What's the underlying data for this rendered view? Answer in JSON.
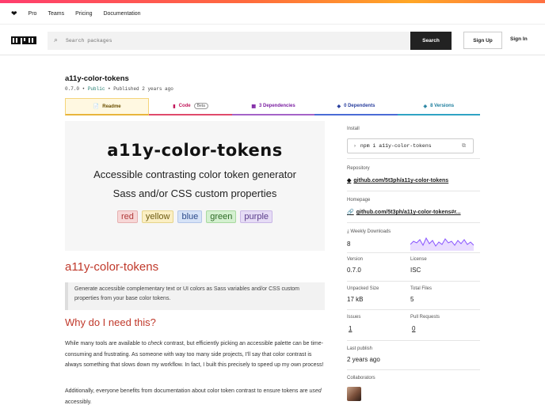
{
  "topnav": {
    "brand_icon": "heart-icon",
    "links": [
      "Pro",
      "Teams",
      "Pricing",
      "Documentation"
    ]
  },
  "header": {
    "logo_text": "npm",
    "search_placeholder": "Search packages",
    "search_button": "Search",
    "signup": "Sign Up",
    "signin": "Sign In"
  },
  "package": {
    "name": "a11y-color-tokens",
    "version": "0.7.0",
    "visibility": "Public",
    "published": "Published 2 years ago"
  },
  "tabs": {
    "readme": "Readme",
    "code": "Code",
    "code_badge": "Beta",
    "dependencies": "3 Dependencies",
    "dependents": "0 Dependents",
    "versions": "8 Versions"
  },
  "banner": {
    "title": "a11y-color-tokens",
    "subtitle1": "Accessible contrasting color token generator",
    "subtitle2": "Sass and/or CSS custom properties",
    "chips": [
      {
        "label": "red",
        "bg": "#f7d7d7",
        "fg": "#b03a3a",
        "border": "#e6b0b0"
      },
      {
        "label": "yellow",
        "bg": "#fbefc4",
        "fg": "#6b5a10",
        "border": "#e6d48a"
      },
      {
        "label": "blue",
        "bg": "#d6e3f7",
        "fg": "#2b4a8a",
        "border": "#b3c6e8"
      },
      {
        "label": "green",
        "bg": "#d4f0d0",
        "fg": "#2d6a25",
        "border": "#a8d9a0"
      },
      {
        "label": "purple",
        "bg": "#e6dcf5",
        "fg": "#5a3c8a",
        "border": "#c9b6e6"
      }
    ]
  },
  "readme": {
    "heading": "a11y-color-tokens",
    "blockquote": "Generate accessible complementary text or UI colors as Sass variables and/or CSS custom properties from your base color tokens.",
    "why_heading": "Why do I need this?",
    "para1_a": "While many tools are available to ",
    "para1_em": "check",
    "para1_b": " contrast, but efficiently picking an accessible palette can be time-consuming and frustrating. As someone with way too many side projects, I'll say that color contrast is always something that slows down my workflow. In fact, I built this precisely to speed up my own process!",
    "para2_a": "Additionally, everyone benefits from documentation about color token contrast to ensure tokens are ",
    "para2_em": "used",
    "para2_b": " accessibly."
  },
  "sidebar": {
    "install_label": "Install",
    "install_cmd": "npm i a11y-color-tokens",
    "repository_label": "Repository",
    "repository_link": "github.com/5t3ph/a11y-color-tokens",
    "homepage_label": "Homepage",
    "homepage_link": "github.com/5t3ph/a11y-color-tokens#r...",
    "weekly_label": "Weekly Downloads",
    "weekly_value": "8",
    "version_label": "Version",
    "version_value": "0.7.0",
    "license_label": "License",
    "license_value": "ISC",
    "unpacked_label": "Unpacked Size",
    "unpacked_value": "17 kB",
    "files_label": "Total Files",
    "files_value": "5",
    "issues_label": "Issues",
    "issues_value": "1",
    "prs_label": "Pull Requests",
    "prs_value": "0",
    "lastpub_label": "Last publish",
    "lastpub_value": "2 years ago",
    "collab_label": "Collaborators"
  },
  "colors": {
    "accent_red": "#c0392b",
    "sparkline": "#8956ff"
  }
}
